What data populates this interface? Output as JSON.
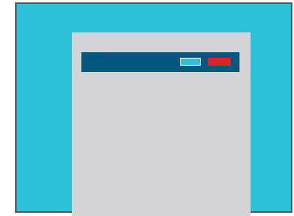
{
  "colors": {
    "background": "#2ec2da",
    "panel": "#d4d4d6",
    "toolbar": "#02577f",
    "accent_button": "#2ec2da",
    "danger_button": "#d7262a",
    "frame_border": "#5a5a5a"
  },
  "toolbar": {
    "buttons": [
      {
        "role": "accent",
        "label": ""
      },
      {
        "role": "danger",
        "label": ""
      }
    ]
  }
}
